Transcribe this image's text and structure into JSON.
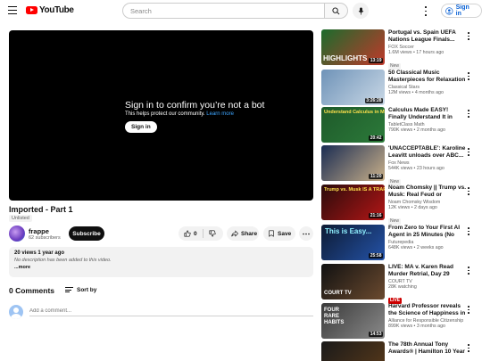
{
  "header": {
    "logo_text": "YouTube",
    "search_placeholder": "Search",
    "signin_label": "Sign in"
  },
  "player": {
    "message_title": "Sign in to confirm you’re not a bot",
    "message_sub": "This helps protect our community.",
    "learn_more": "Learn more",
    "signin_label": "Sign in"
  },
  "video": {
    "title": "Imported - Part 1",
    "visibility": "Unlisted",
    "channel_name": "frappe",
    "subscribers": "62 subscribers",
    "subscribe_label": "Subscribe",
    "likes": "0",
    "share_label": "Share",
    "save_label": "Save",
    "meta": "20 views  1 year ago",
    "description": "No description has been added to this video.",
    "more_label": "...more"
  },
  "comments": {
    "count_label": "0 Comments",
    "sort_label": "Sort by",
    "input_placeholder": "Add a comment..."
  },
  "recommendations": [
    {
      "title": "Portugal vs. Spain UEFA Nations League Finals...",
      "channel": "FOX Soccer",
      "views": "1.6M views • 17 hours ago",
      "badge": "New",
      "duration": "13:19",
      "thumb_caption": "HIGHLIGHTS",
      "colors": [
        "#1b6b2c",
        "#c0392b"
      ]
    },
    {
      "title": "50 Classical Music Masterpieces for Relaxation &...",
      "channel": "Classical Stars",
      "views": "12M views • 4 months ago",
      "badge": "",
      "duration": "3:26:28",
      "thumb_caption": "",
      "colors": [
        "#6f93b8",
        "#c9d8e6"
      ]
    },
    {
      "title": "Calculus Made EASY! Finally Understand It in Minutes!",
      "channel": "TabletClass Math",
      "views": "790K views • 2 months ago",
      "badge": "",
      "duration": "20:42",
      "thumb_caption": "Understand Calculus in Minutes",
      "colors": [
        "#1e5a2a",
        "#2c7a3a"
      ]
    },
    {
      "title": "'UNACCEPTABLE': Karoline Leavitt unloads over ABC...",
      "channel": "Fox News",
      "views": "544K views • 23 hours ago",
      "badge": "New",
      "duration": "11:20",
      "thumb_caption": "",
      "colors": [
        "#1a2c52",
        "#c9b08a"
      ]
    },
    {
      "title": "Noam Chomsky || Trump vs. Musk: Real Feud or Corporate...",
      "channel": "Noam Chomsky Wisdom",
      "views": "12K views • 2 days ago",
      "badge": "New",
      "duration": "21:16",
      "thumb_caption": "Trump vs. Musk IS A TRAP",
      "colors": [
        "#2a0b0b",
        "#b31616"
      ]
    },
    {
      "title": "From Zero to Your First AI Agent in 25 Minutes (No Coding)",
      "channel": "Futurepedia",
      "views": "648K views • 2 weeks ago",
      "badge": "",
      "duration": "25:58",
      "thumb_caption": "This is Easy...",
      "colors": [
        "#0d1a33",
        "#2453a8"
      ]
    },
    {
      "title": "LIVE: MA v. Karen Read Murder Retrial, Day 29",
      "channel": "COURT TV",
      "views": "28K watching",
      "badge": "LIVE",
      "duration": "",
      "thumb_caption": "COURT TV",
      "colors": [
        "#111111",
        "#6b4a2f"
      ]
    },
    {
      "title": "Harvard Professor reveals the Science of Happiness in 15...",
      "channel": "Alliance for Responsible Citizenship",
      "views": "899K views • 3 months ago",
      "badge": "",
      "duration": "14:53",
      "thumb_caption": "FOUR RARE HABITS",
      "colors": [
        "#3a3a3a",
        "#8a8a8a"
      ]
    },
    {
      "title": "The 78th Annual Tony Awards® | Hamilton 10 Year Anniversar...",
      "channel": "",
      "views": "",
      "badge": "",
      "duration": "",
      "thumb_caption": "",
      "colors": [
        "#1a1a1a",
        "#5a3a1a"
      ]
    }
  ]
}
